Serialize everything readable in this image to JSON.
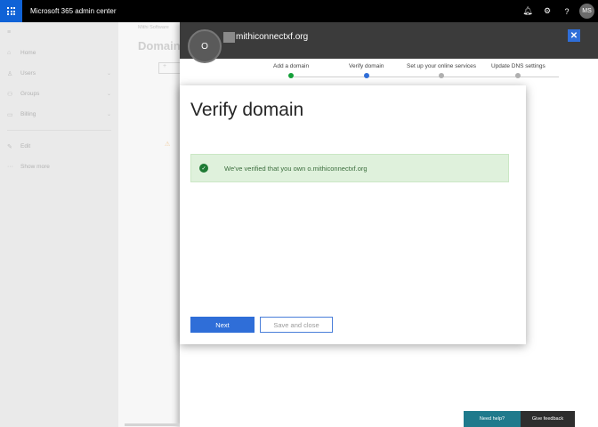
{
  "app": {
    "title": "Microsoft 365 admin center",
    "user_initials": "MS"
  },
  "topbar": {
    "icons": [
      {
        "name": "bell-icon",
        "glyph": "🔔︎"
      },
      {
        "name": "gear-icon",
        "glyph": "⚙"
      },
      {
        "name": "help-icon",
        "glyph": "?"
      }
    ]
  },
  "sidebar": {
    "collapse_glyph": "≡",
    "items": [
      {
        "label": "Home",
        "icon": "⌂",
        "expandable": false
      },
      {
        "label": "Users",
        "icon": "♙",
        "expandable": true
      },
      {
        "label": "Groups",
        "icon": "⚇",
        "expandable": true
      },
      {
        "label": "Billing",
        "icon": "▭",
        "expandable": true
      }
    ],
    "secondary": [
      {
        "label": "Edit",
        "icon": "✎"
      },
      {
        "label": "Show more",
        "icon": "···"
      }
    ]
  },
  "background_page": {
    "breadcrumb": "Mithi Software",
    "title": "Domain",
    "button_glyph": "+",
    "warning_glyph": "⚠"
  },
  "panel": {
    "logo_letter": "O",
    "domain": "mithiconnectxf.org",
    "close_glyph": "✕",
    "steps": [
      {
        "label": "Add a domain",
        "status": "done"
      },
      {
        "label": "Verify domain",
        "status": "current"
      },
      {
        "label": "Set up your online services",
        "status": "todo"
      },
      {
        "label": "Update DNS settings",
        "status": "todo"
      }
    ],
    "card": {
      "title": "Verify domain",
      "alert_text": "We've verified that you own o.mithiconnectxf.org",
      "alert_icon": "✓",
      "next_label": "Next",
      "save_close_label": "Save and close"
    }
  },
  "footer": {
    "help_label": "Need help?",
    "feedback_label": "Give feedback"
  },
  "colors": {
    "accent": "#2f6ed8",
    "success_bg": "#dff1dc",
    "success_icon": "#1e7a34",
    "topbar": "#000000"
  }
}
